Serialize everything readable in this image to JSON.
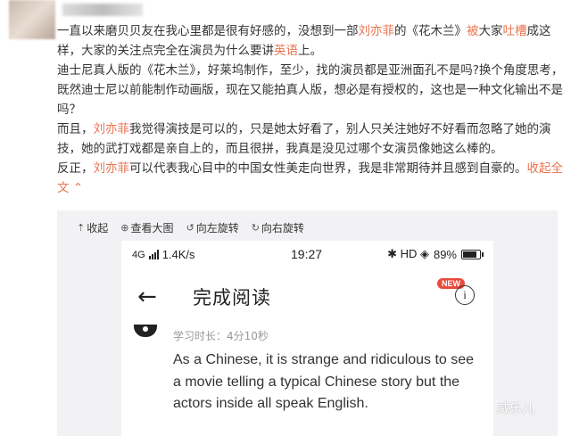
{
  "post": {
    "p1": {
      "t1": "一直以来磨贝贝友在我心里都是很有好感的，没想到一部",
      "name": "刘亦菲",
      "t2": "的《花木兰》",
      "bei": "被",
      "t3": "大家",
      "tucao": "吐槽",
      "t4": "成这样，大家的关注点完全在演员为什么要讲",
      "english": "英语",
      "t5": "上。"
    },
    "p2": "迪士尼真人版的《花木兰》，好莱坞制作，至少，找的演员都是亚洲面孔不是吗?换个角度思考，既然迪士尼以前能制作动画版，现在又能拍真人版，想必是有授权的，这也是一种文化输出不是吗？",
    "p3": {
      "t1": "而且，",
      "name": "刘亦菲",
      "t2": "我觉得演技是可以的，只是她太好看了，别人只关注她好不好看而忽略了她的演技，她的武打戏都是亲自上的，而且很拼，我真是没见过哪个女演员像她这么棒的。"
    },
    "p4": {
      "t1": "反正，",
      "name": "刘亦菲",
      "t2": "可以代表我心目中的中国女性美走向世界，我是非常期待并且感到自豪的。",
      "collapse": "收起全文",
      "collapse_icon": "chevron-up-icon"
    }
  },
  "toolbar": {
    "collapse_label": "收起",
    "view_large_label": "查看大图",
    "rotate_left_label": "向左旋转",
    "rotate_right_label": "向右旋转"
  },
  "phone": {
    "network": "4G",
    "speed": "1.4K/s",
    "time": "19:27",
    "status_icons": "✱ HD ◈",
    "battery": "89%",
    "back_glyph": "←",
    "title": "完成阅读",
    "new_badge": "NEW",
    "info_glyph": "i",
    "duration": "学习时长：4分10秒",
    "quote": "As a Chinese, it is strange and ridiculous to see a movie telling a typical Chinese story but the actors inside all speak English."
  },
  "watermark": "威乐儿",
  "colors": {
    "highlight": "#eb7350",
    "panel_bg": "#f2f2f5",
    "badge": "#e94a3b"
  }
}
